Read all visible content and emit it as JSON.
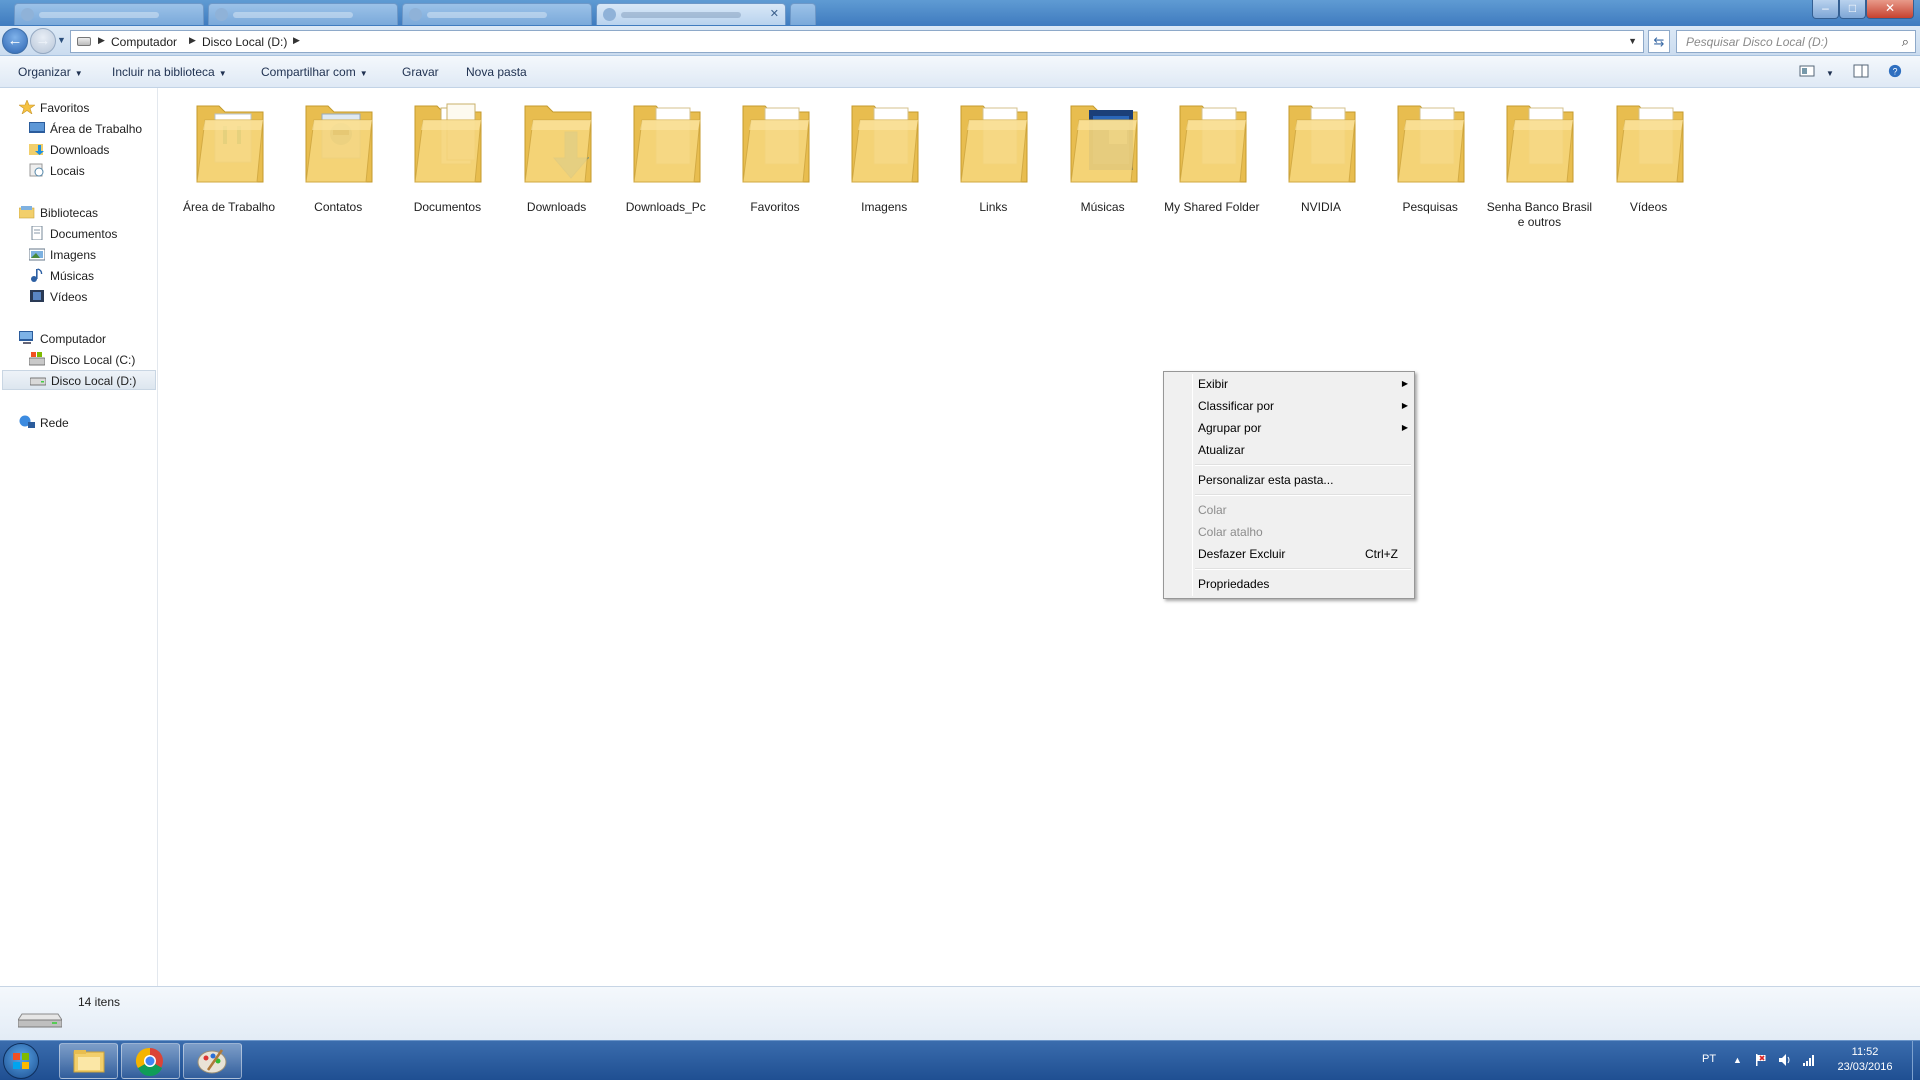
{
  "window": {
    "controls": {
      "minimize": "–",
      "maximize": "□",
      "close": "✕"
    }
  },
  "navigation": {
    "back_icon": "arrow-left-icon",
    "forward_icon": "arrow-right-icon",
    "breadcrumbs": [
      "Computador",
      "Disco Local (D:)"
    ],
    "refresh_glyph": "⇆",
    "search_placeholder": "Pesquisar Disco Local (D:)"
  },
  "toolbar": {
    "organize": "Organizar",
    "include_library": "Incluir na biblioteca",
    "share_with": "Compartilhar com",
    "burn": "Gravar",
    "new_folder": "Nova pasta"
  },
  "sidebar": {
    "favorites": {
      "title": "Favoritos",
      "items": [
        "Área de Trabalho",
        "Downloads",
        "Locais"
      ]
    },
    "libraries": {
      "title": "Bibliotecas",
      "items": [
        "Documentos",
        "Imagens",
        "Músicas",
        "Vídeos"
      ]
    },
    "computer": {
      "title": "Computador",
      "items": [
        "Disco Local (C:)",
        "Disco Local (D:)"
      ],
      "selected": "Disco Local (D:)"
    },
    "network": {
      "title": "Rede"
    }
  },
  "folders": [
    {
      "name": "Área de Trabalho",
      "icon": "folder-desktop-icon"
    },
    {
      "name": "Contatos",
      "icon": "folder-contacts-icon"
    },
    {
      "name": "Documentos",
      "icon": "folder-documents-icon"
    },
    {
      "name": "Downloads",
      "icon": "folder-downloads-icon"
    },
    {
      "name": "Downloads_Pc",
      "icon": "folder-icon"
    },
    {
      "name": "Favoritos",
      "icon": "folder-icon"
    },
    {
      "name": "Imagens",
      "icon": "folder-icon"
    },
    {
      "name": "Links",
      "icon": "folder-icon"
    },
    {
      "name": "Músicas",
      "icon": "folder-music-icon"
    },
    {
      "name": "My Shared Folder",
      "icon": "folder-icon"
    },
    {
      "name": "NVIDIA",
      "icon": "folder-icon"
    },
    {
      "name": "Pesquisas",
      "icon": "folder-icon"
    },
    {
      "name": "Senha  Banco Brasil e outros",
      "icon": "folder-icon"
    },
    {
      "name": "Vídeos",
      "icon": "folder-icon"
    }
  ],
  "context_menu": {
    "view": "Exibir",
    "sort_by": "Classificar por",
    "group_by": "Agrupar por",
    "refresh": "Atualizar",
    "customize": "Personalizar esta pasta...",
    "paste": "Colar",
    "paste_shortcut": "Colar atalho",
    "undo_delete": "Desfazer Excluir",
    "undo_delete_shortcut": "Ctrl+Z",
    "properties": "Propriedades"
  },
  "status": {
    "item_count": "14 itens"
  },
  "taskbar": {
    "language": "PT",
    "time": "11:52",
    "date": "23/03/2016"
  },
  "colors": {
    "accent": "#3f7bbf",
    "taskbar": "#1f4f92",
    "folder_yellow": "#f2cf6b",
    "download_arrow": "#1d8fe0"
  }
}
